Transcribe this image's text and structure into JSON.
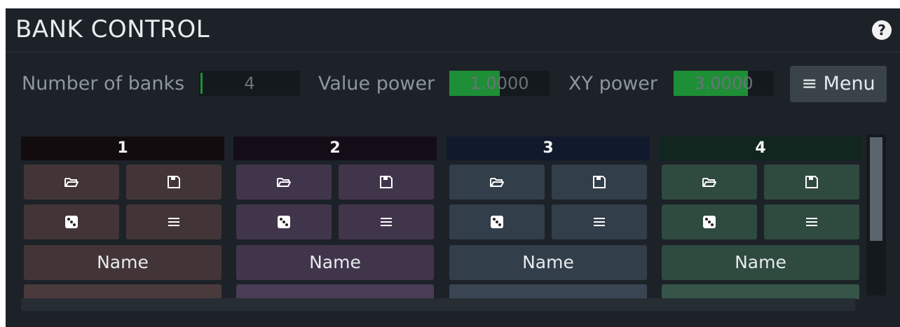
{
  "header": {
    "title": "BANK CONTROL",
    "help_label": "?"
  },
  "controls": {
    "number_of_banks": {
      "label": "Number of banks",
      "value": "4",
      "fill": 0.0
    },
    "value_power": {
      "label": "Value power",
      "value": "1.0000",
      "fill": 0.5
    },
    "xy_power": {
      "label": "XY power",
      "value": "3.0000",
      "fill": 0.74
    },
    "menu_label": "≡ Menu"
  },
  "banks": [
    {
      "title": "1",
      "name_label": "Name",
      "colors": {
        "head": "#120c0f",
        "button": "#433537",
        "stub": "#4a3a3c"
      }
    },
    {
      "title": "2",
      "name_label": "Name",
      "colors": {
        "head": "#140d18",
        "button": "#41354b",
        "stub": "#4a3c55"
      }
    },
    {
      "title": "3",
      "name_label": "Name",
      "colors": {
        "head": "#101a2c",
        "button": "#333e4b",
        "stub": "#3a4554"
      }
    },
    {
      "title": "4",
      "name_label": "Name",
      "colors": {
        "head": "#11261e",
        "button": "#2f4a3f",
        "stub": "#365447"
      }
    }
  ],
  "icons": {
    "open": "folder-icon",
    "save": "floppy-icon",
    "random": "dice-icon",
    "menu": "hamburger-icon"
  }
}
